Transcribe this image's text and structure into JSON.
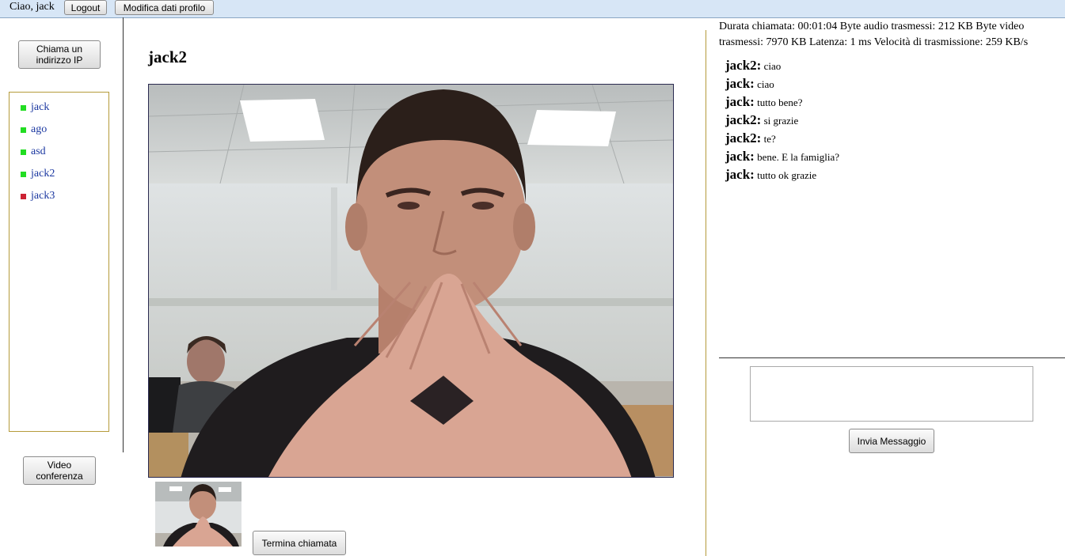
{
  "header": {
    "greeting": "Ciao, jack",
    "logout_label": "Logout",
    "edit_profile_label": "Modifica dati profilo"
  },
  "sidebar": {
    "call_ip_label_line1": "Chiama un",
    "call_ip_label_line2": "indirizzo IP",
    "contacts": [
      {
        "name": "jack",
        "status": "online",
        "color": "#22dd22"
      },
      {
        "name": "ago",
        "status": "online",
        "color": "#22dd22"
      },
      {
        "name": "asd",
        "status": "online",
        "color": "#22dd22"
      },
      {
        "name": "jack2",
        "status": "online",
        "color": "#22dd22"
      },
      {
        "name": "jack3",
        "status": "offline",
        "color": "#cc2233"
      }
    ],
    "video_conference_line1": "Video",
    "video_conference_line2": "conferenza"
  },
  "call": {
    "remote_user": "jack2",
    "end_call_label": "Termina chiamata"
  },
  "stats": {
    "text": "Durata chiamata: 00:01:04 Byte audio trasmessi: 212 KB Byte video trasmessi: 7970 KB Latenza: 1 ms Velocità di trasmissione: 259 KB/s"
  },
  "chat": {
    "messages": [
      {
        "sender": "jack2:",
        "text": "ciao"
      },
      {
        "sender": "jack:",
        "text": "ciao"
      },
      {
        "sender": "jack:",
        "text": "tutto bene?"
      },
      {
        "sender": "jack2:",
        "text": "si grazie"
      },
      {
        "sender": "jack2:",
        "text": "te?"
      },
      {
        "sender": "jack:",
        "text": "bene. E la famiglia?"
      },
      {
        "sender": "jack:",
        "text": "tutto ok grazie"
      }
    ],
    "message_value": "",
    "send_label": "Invia Messaggio"
  }
}
